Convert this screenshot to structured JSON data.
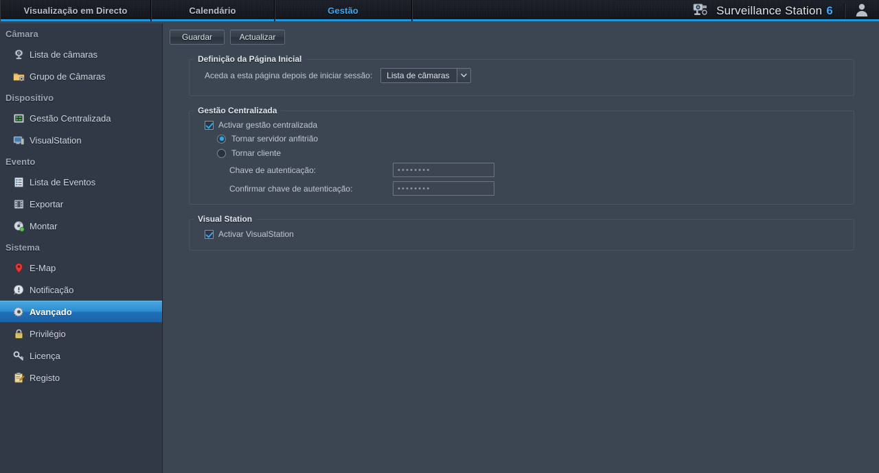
{
  "header": {
    "tabs": [
      {
        "label": "Visualização em Directo",
        "active": false
      },
      {
        "label": "Calendário",
        "active": false
      },
      {
        "label": "Gestão",
        "active": true
      }
    ],
    "brand_name": "Surveillance Station",
    "brand_version": "6",
    "camera_icon": "camera-icon",
    "user_icon": "user-icon"
  },
  "sidebar": {
    "sections": [
      {
        "title": "Câmara",
        "items": [
          {
            "label": "Lista de câmaras",
            "icon": "camera-icon",
            "selected": false
          },
          {
            "label": "Grupo de Câmaras",
            "icon": "folder-camera-icon",
            "selected": false
          }
        ]
      },
      {
        "title": "Dispositivo",
        "items": [
          {
            "label": "Gestão Centralizada",
            "icon": "server-list-icon",
            "selected": false
          },
          {
            "label": "VisualStation",
            "icon": "monitor-icon",
            "selected": false
          }
        ]
      },
      {
        "title": "Evento",
        "items": [
          {
            "label": "Lista de Eventos",
            "icon": "list-icon",
            "selected": false
          },
          {
            "label": "Exportar",
            "icon": "film-icon",
            "selected": false
          },
          {
            "label": "Montar",
            "icon": "disc-icon",
            "selected": false
          }
        ]
      },
      {
        "title": "Sistema",
        "items": [
          {
            "label": "E-Map",
            "icon": "map-pin-icon",
            "selected": false
          },
          {
            "label": "Notificação",
            "icon": "alert-icon",
            "selected": false
          },
          {
            "label": "Avançado",
            "icon": "gear-icon",
            "selected": true
          },
          {
            "label": "Privilégio",
            "icon": "lock-icon",
            "selected": false
          },
          {
            "label": "Licença",
            "icon": "key-icon",
            "selected": false
          },
          {
            "label": "Registo",
            "icon": "clipboard-pencil-icon",
            "selected": false
          }
        ]
      }
    ]
  },
  "toolbar": {
    "save_label": "Guardar",
    "refresh_label": "Actualizar"
  },
  "homepage_group": {
    "legend": "Definição da Página Inicial",
    "field_label": "Aceda a esta página depois de iniciar sessão:",
    "select_value": "Lista de câmaras",
    "select_options": [
      "Lista de câmaras"
    ],
    "arrow_icon": "chevron-down-icon"
  },
  "central_group": {
    "legend": "Gestão Centralizada",
    "enable_label": "Activar gestão centralizada",
    "enable_checked": true,
    "host_label": "Tornar servidor anfitrião",
    "host_selected": true,
    "client_label": "Tornar cliente",
    "client_selected": false,
    "auth_key_label": "Chave de autenticação:",
    "auth_key_value": "••••••••",
    "auth_key_confirm_label": "Confirmar chave de autenticação:",
    "auth_key_confirm_value": "••••••••"
  },
  "visualstation_group": {
    "legend": "Visual Station",
    "enable_label": "Activar VisualStation",
    "enable_checked": true
  },
  "colors": {
    "accent": "#2196dd",
    "selected_row": "#2f8dd0",
    "page_bg": "#3c4552",
    "sidebar_bg": "#313846",
    "header_bg": "#14171e"
  }
}
